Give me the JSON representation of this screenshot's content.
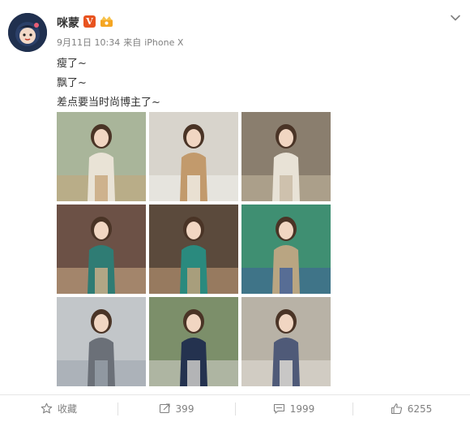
{
  "post": {
    "username": "咪蒙",
    "verified_badge": "V",
    "meta": {
      "date": "9月11日 10:34",
      "source_prefix": "来自",
      "source": "iPhone X"
    },
    "text_lines": [
      "瘦了~",
      "飘了~",
      "差点要当时尚博主了~"
    ],
    "photos": [
      {
        "name": "photo-1",
        "palette": [
          "#a9b59a",
          "#e9e3d6",
          "#c7a57a"
        ]
      },
      {
        "name": "photo-2",
        "palette": [
          "#d8d4cc",
          "#c29a6c",
          "#f3f1ec"
        ]
      },
      {
        "name": "photo-3",
        "palette": [
          "#8a7e6e",
          "#e8e2d6",
          "#c7b9a2"
        ]
      },
      {
        "name": "photo-4",
        "palette": [
          "#6c5146",
          "#2f7c74",
          "#d2b08a"
        ]
      },
      {
        "name": "photo-5",
        "palette": [
          "#5b4a3c",
          "#2a8a7e",
          "#c8a27c"
        ]
      },
      {
        "name": "photo-6",
        "palette": [
          "#3f8f72",
          "#b9a582",
          "#3f5f9a"
        ]
      },
      {
        "name": "photo-7",
        "palette": [
          "#c2c6c9",
          "#6b7078",
          "#9aa3ab"
        ]
      },
      {
        "name": "photo-8",
        "palette": [
          "#7c8f6a",
          "#24324f",
          "#d7d5cf"
        ]
      },
      {
        "name": "photo-9",
        "palette": [
          "#b8b2a6",
          "#4f5a78",
          "#e6e2da"
        ]
      }
    ]
  },
  "actions": {
    "favorite_label": "收藏",
    "repost_count": "399",
    "comment_count": "1999",
    "like_count": "6255"
  },
  "icons": {
    "more": "chevron-down-icon",
    "favorite": "star-icon",
    "repost": "repost-icon",
    "comment": "comment-icon",
    "like": "thumbs-up-icon"
  },
  "colors": {
    "badge_bg": "#e8531f",
    "meta_text": "#808080",
    "text": "#333333",
    "divider": "#e6e6e6"
  }
}
